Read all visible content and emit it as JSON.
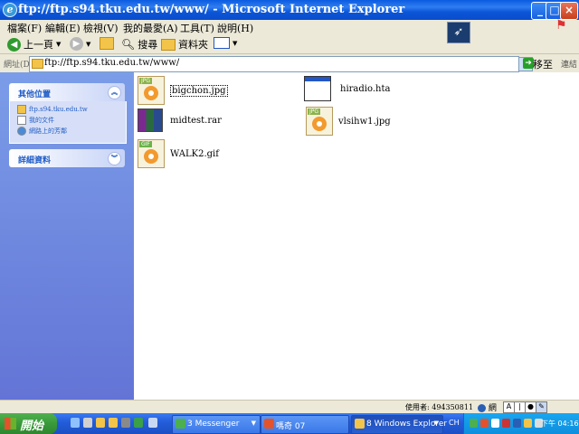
{
  "window": {
    "title": "ftp://ftp.s94.tku.edu.tw/www/ - Microsoft Internet Explorer"
  },
  "menu": [
    "檔案(F)",
    "編輯(E)",
    "檢視(V)",
    "我的最愛(A)",
    "工具(T)",
    "說明(H)"
  ],
  "toolbar": {
    "back_label": "上一頁",
    "search_label": "搜尋",
    "folders_label": "資料夾"
  },
  "address": {
    "label": "網址(D)",
    "value": "ftp://ftp.s94.tku.edu.tw/www/",
    "go_label": "移至",
    "links_label": "連結"
  },
  "sidebar": {
    "other_places": {
      "title": "其他位置",
      "items": [
        "ftp.s94.tku.edu.tw",
        "我的文件",
        "網路上的芳鄰"
      ]
    },
    "details": {
      "title": "詳細資料"
    }
  },
  "files": [
    {
      "name": "bigchon.jpg",
      "type": "jpg",
      "selected": true
    },
    {
      "name": "hiradio.hta",
      "type": "hta"
    },
    {
      "name": "midtest.rar",
      "type": "rar"
    },
    {
      "name": "vlsihw1.jpg",
      "type": "jpg"
    },
    {
      "name": "WALK2.gif",
      "type": "gif"
    }
  ],
  "file_type_tags": {
    "jpg": "JPG",
    "gif": "GIF"
  },
  "status": {
    "used": "使用者: 494350811",
    "zone": "網"
  },
  "taskbar": {
    "start_label": "開始",
    "tasks": [
      {
        "label": "3 Messenger"
      },
      {
        "label": "嗎奇 07"
      },
      {
        "label": "8 Windows Explorer"
      }
    ],
    "lang": "CH",
    "clock": "下午 04:16"
  },
  "colors": {
    "titlebar": "#0a5be0",
    "sidebar": "#7b9de8",
    "taskbar": "#245edb",
    "start": "#3a9a3a"
  }
}
